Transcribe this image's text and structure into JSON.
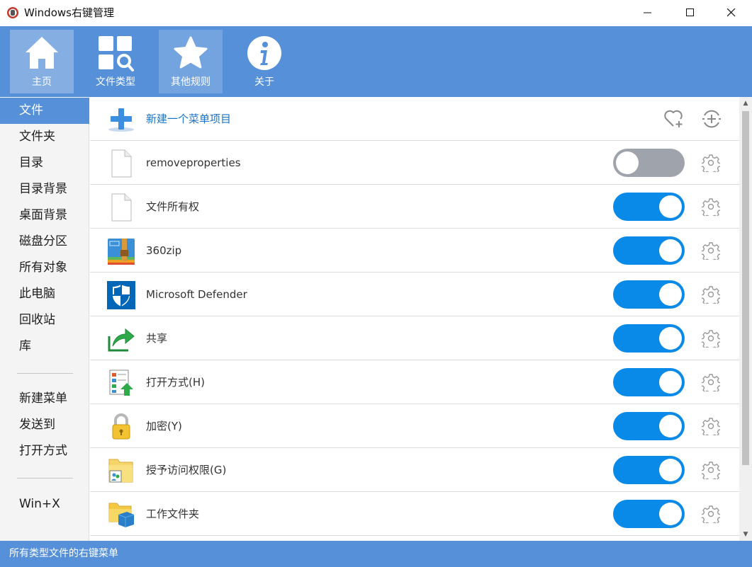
{
  "window": {
    "title": "Windows右键管理",
    "controls": [
      "minimize-icon",
      "maximize-icon",
      "close-icon"
    ]
  },
  "toolbar": {
    "items": [
      {
        "label": "主页",
        "icon": "home-icon",
        "state": "active"
      },
      {
        "label": "文件类型",
        "icon": "file-type-search-icon",
        "state": "normal"
      },
      {
        "label": "其他规则",
        "icon": "star-icon",
        "state": "hovered"
      },
      {
        "label": "关于",
        "icon": "info-icon",
        "state": "normal"
      }
    ]
  },
  "sidebar": {
    "items": [
      {
        "label": "文件",
        "selected": true
      },
      {
        "label": "文件夹"
      },
      {
        "label": "目录"
      },
      {
        "label": "目录背景"
      },
      {
        "label": "桌面背景"
      },
      {
        "label": "磁盘分区"
      },
      {
        "label": "所有对象"
      },
      {
        "label": "此电脑"
      },
      {
        "label": "回收站"
      },
      {
        "label": "库"
      },
      {
        "label": "新建菜单"
      },
      {
        "label": "发送到"
      },
      {
        "label": "打开方式"
      },
      {
        "label": "Win+X"
      }
    ]
  },
  "list": {
    "new_item_label": "新建一个菜单项目",
    "header_icons": [
      "favorite-add-icon",
      "add-circle-icon"
    ],
    "rows": [
      {
        "label": "removeproperties",
        "icon": "blank-file-icon",
        "enabled": false
      },
      {
        "label": "文件所有权",
        "icon": "blank-file-icon",
        "enabled": true
      },
      {
        "label": "360zip",
        "icon": "zip-archive-icon",
        "enabled": true
      },
      {
        "label": "Microsoft Defender",
        "icon": "defender-shield-icon",
        "enabled": true
      },
      {
        "label": "共享",
        "icon": "share-icon",
        "enabled": true
      },
      {
        "label": "打开方式(H)",
        "icon": "open-with-icon",
        "enabled": true
      },
      {
        "label": "加密(Y)",
        "icon": "lock-icon",
        "enabled": true
      },
      {
        "label": "授予访问权限(G)",
        "icon": "grant-access-icon",
        "enabled": true
      },
      {
        "label": "工作文件夹",
        "icon": "work-folder-icon",
        "enabled": true
      }
    ]
  },
  "status": {
    "text": "所有类型文件的右键菜单"
  },
  "colors": {
    "accent": "#5690d9",
    "toggle_on": "#0a8ae8",
    "toggle_off": "#9fa3ab",
    "link": "#1a73c9"
  }
}
